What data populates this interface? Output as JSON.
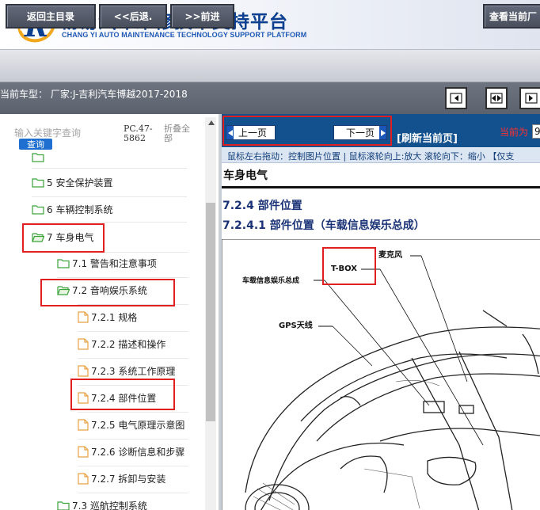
{
  "header": {
    "title": "畅易汽车维修技术支持平台",
    "subtitle": "CHANG YI AUTO MAINTENANCE TECHNOLOGY SUPPORT PLATFORM"
  },
  "toolbar": {
    "home_label": "返回主目录",
    "back_label": "<<后退.",
    "forward_label": ">>前进",
    "view_current_label": "查看当前厂"
  },
  "vehicle": {
    "text": "当前车型： 厂家:J-吉利汽车博越2017-2018"
  },
  "left_panel": {
    "search_placeholder": "输入关键字查询",
    "query_label": "查询",
    "pc_code": "PC.47-5862",
    "fold_all_label": "折叠全部",
    "tree": [
      {
        "label": "5 安全保护装置",
        "type": "folder"
      },
      {
        "label": "6 车辆控制系统",
        "type": "folder"
      },
      {
        "label": "7 车身电气",
        "type": "folder-open"
      },
      {
        "label": "7.1 警告和注意事项",
        "type": "folder"
      },
      {
        "label": "7.2 音响娱乐系统",
        "type": "folder-open"
      },
      {
        "label": "7.2.1 规格",
        "type": "page"
      },
      {
        "label": "7.2.2 描述和操作",
        "type": "page"
      },
      {
        "label": "7.2.3 系统工作原理",
        "type": "page"
      },
      {
        "label": "7.2.4 部件位置",
        "type": "page"
      },
      {
        "label": "7.2.5 电气原理示意图",
        "type": "page"
      },
      {
        "label": "7.2.6 诊断信息和步骤",
        "type": "page"
      },
      {
        "label": "7.2.7 拆卸与安装",
        "type": "page"
      },
      {
        "label": "7.3 巡航控制系统",
        "type": "folder"
      }
    ]
  },
  "navigation": {
    "prev_label": "上一页",
    "next_label": "下一页",
    "refresh_label": "[刷新当前页]",
    "current_label": "当前为",
    "current_page": "9"
  },
  "hint": {
    "text": "鼠标左右拖动：控制图片位置 | 鼠标滚轮向上:放大  滚轮向下：缩小 【仅支"
  },
  "document": {
    "section_title": "车身电气",
    "heading1": "7.2.4 部件位置",
    "heading2": "7.2.4.1 部件位置（车载信息娱乐总成）",
    "callouts": {
      "microphone": "麦克风",
      "tbox": "T-BOX",
      "infotainment": "车载信息娱乐总成",
      "gps": "GPS天线"
    }
  },
  "colors": {
    "brand_blue": "#0c3f8f",
    "nav_blue": "#12508e",
    "highlight_red": "#e02020",
    "folder_green": "#3aa339",
    "page_orange": "#e8a040"
  }
}
